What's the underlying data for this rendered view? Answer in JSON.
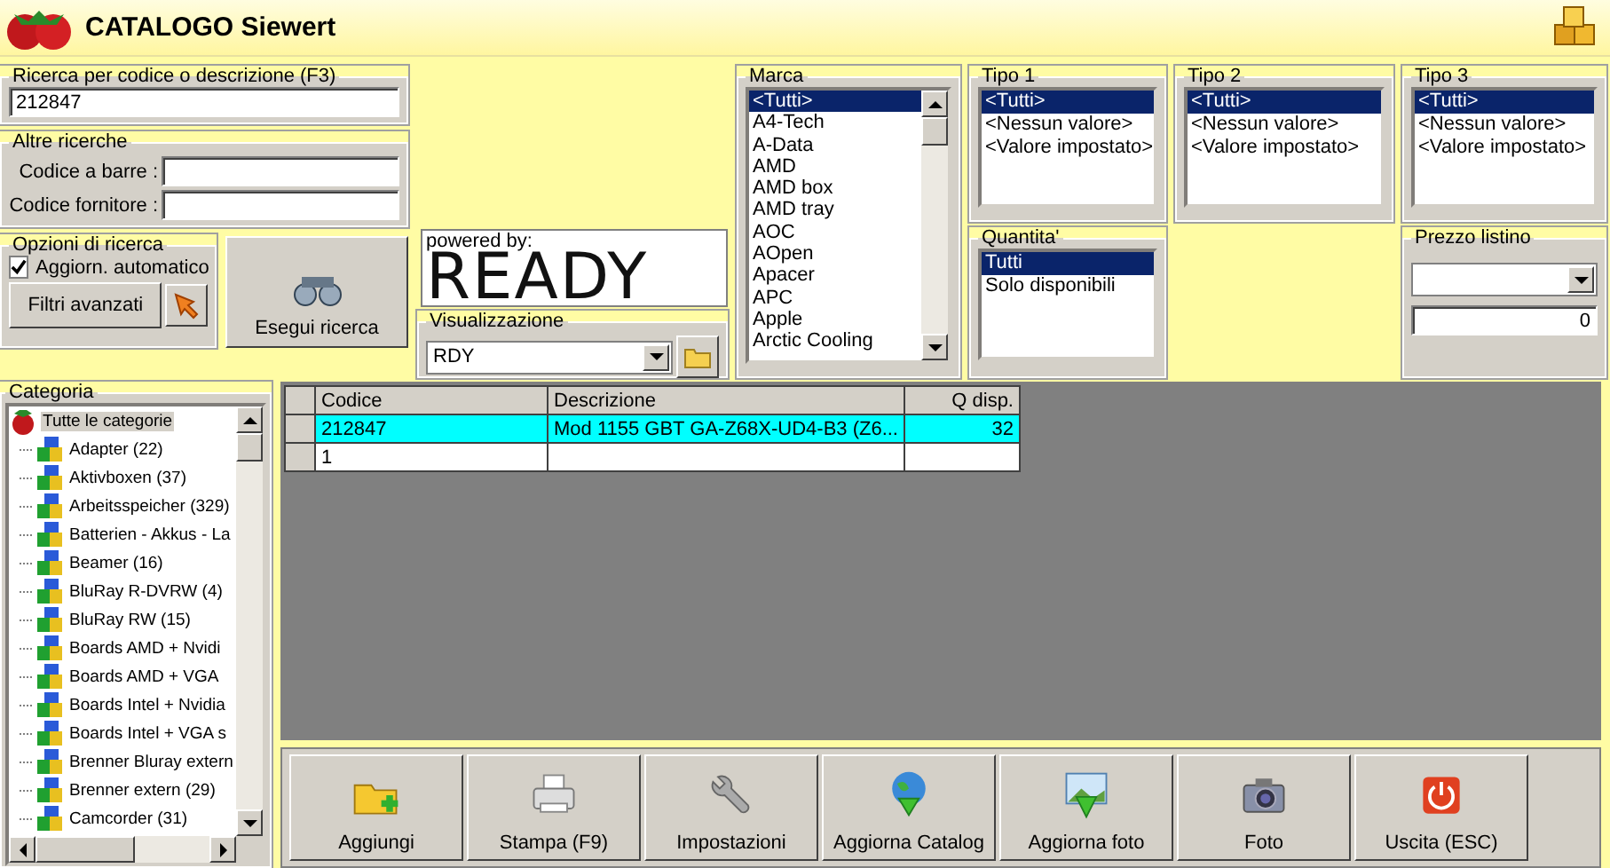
{
  "window": {
    "title": "CATALOGO Siewert"
  },
  "search": {
    "legend": "Ricerca per codice o descrizione (F3)",
    "value": "212847"
  },
  "other_searches": {
    "legend": "Altre ricerche",
    "fields": [
      {
        "label": "Codice a barre :"
      },
      {
        "label": "Codice fornitore :"
      }
    ]
  },
  "search_options": {
    "legend": "Opzioni di ricerca",
    "auto_update": {
      "label": "Aggiorn. automatico",
      "checked": true
    },
    "advanced_filters_button": "Filtri avanzati"
  },
  "run_search_button": "Esegui ricerca",
  "powered_by": {
    "caption": "powered by:",
    "logo": "READY"
  },
  "view": {
    "legend": "Visualizzazione",
    "value": "RDY"
  },
  "brand": {
    "legend": "Marca",
    "items": [
      {
        "label": "<Tutti>",
        "selected": true
      },
      {
        "label": "A4-Tech",
        "selected": false
      },
      {
        "label": "A-Data",
        "selected": false
      },
      {
        "label": "AMD",
        "selected": false
      },
      {
        "label": "AMD box",
        "selected": false
      },
      {
        "label": "AMD tray",
        "selected": false
      },
      {
        "label": "AOC",
        "selected": false
      },
      {
        "label": "AOpen",
        "selected": false
      },
      {
        "label": "Apacer",
        "selected": false
      },
      {
        "label": "APC",
        "selected": false
      },
      {
        "label": "Apple",
        "selected": false
      },
      {
        "label": "Arctic Cooling",
        "selected": false
      }
    ]
  },
  "type_1": {
    "legend": "Tipo 1",
    "items": [
      {
        "label": "<Tutti>",
        "selected": true
      },
      {
        "label": "<Nessun valore>",
        "selected": false
      },
      {
        "label": "<Valore impostato>",
        "selected": false
      }
    ]
  },
  "quantity": {
    "legend": "Quantita'",
    "items": [
      {
        "label": "Tutti",
        "selected": true
      },
      {
        "label": "Solo disponibili",
        "selected": false
      }
    ]
  },
  "type_2": {
    "legend": "Tipo 2",
    "items": [
      {
        "label": "<Tutti>",
        "selected": true
      },
      {
        "label": "<Nessun valore>",
        "selected": false
      },
      {
        "label": "<Valore impostato>",
        "selected": false
      }
    ]
  },
  "type_3": {
    "legend": "Tipo 3",
    "items": [
      {
        "label": "<Tutti>",
        "selected": true
      },
      {
        "label": "<Nessun valore>",
        "selected": false
      },
      {
        "label": "<Valore impostato>",
        "selected": false
      }
    ]
  },
  "list_price": {
    "legend": "Prezzo listino",
    "value": "0"
  },
  "category": {
    "legend": "Categoria",
    "root": {
      "label": "Tutte le categorie",
      "selected": true,
      "children": [
        {
          "label": "Adapter (22)",
          "selected": false
        },
        {
          "label": "Aktivboxen (37)",
          "selected": false
        },
        {
          "label": "Arbeitsspeicher (329)",
          "selected": false
        },
        {
          "label": "Batterien - Akkus - La",
          "selected": false
        },
        {
          "label": "Beamer (16)",
          "selected": false
        },
        {
          "label": "BluRay R-DVRW (4)",
          "selected": false
        },
        {
          "label": "BluRay RW (15)",
          "selected": false
        },
        {
          "label": "Boards AMD + Nvidi",
          "selected": false
        },
        {
          "label": "Boards AMD + VGA",
          "selected": false
        },
        {
          "label": "Boards Intel + Nvidia",
          "selected": false
        },
        {
          "label": "Boards Intel + VGA s",
          "selected": false
        },
        {
          "label": "Brenner Bluray extern",
          "selected": false
        },
        {
          "label": "Brenner extern (29)",
          "selected": false
        },
        {
          "label": "Camcorder (31)",
          "selected": false
        }
      ]
    }
  },
  "table": {
    "columns": [
      "Codice",
      "Descrizione",
      "Q disp."
    ],
    "rows": [
      {
        "codice": "212847",
        "descrizione": "Mod 1155 GBT GA-Z68X-UD4-B3 (Z6...",
        "q_disp": "32",
        "selected": true
      },
      {
        "codice": "1",
        "selected": false
      }
    ]
  },
  "toolbar": [
    {
      "kind": "add",
      "label": "Aggiungi"
    },
    {
      "kind": "print",
      "label": "Stampa (F9)"
    },
    {
      "kind": "settings",
      "label": "Impostazioni"
    },
    {
      "kind": "update",
      "label": "Aggiorna Catalog"
    },
    {
      "kind": "photo_update",
      "label": "Aggiorna foto"
    },
    {
      "kind": "camera",
      "label": "Foto"
    },
    {
      "kind": "exit",
      "label": "Uscita (ESC)"
    }
  ]
}
